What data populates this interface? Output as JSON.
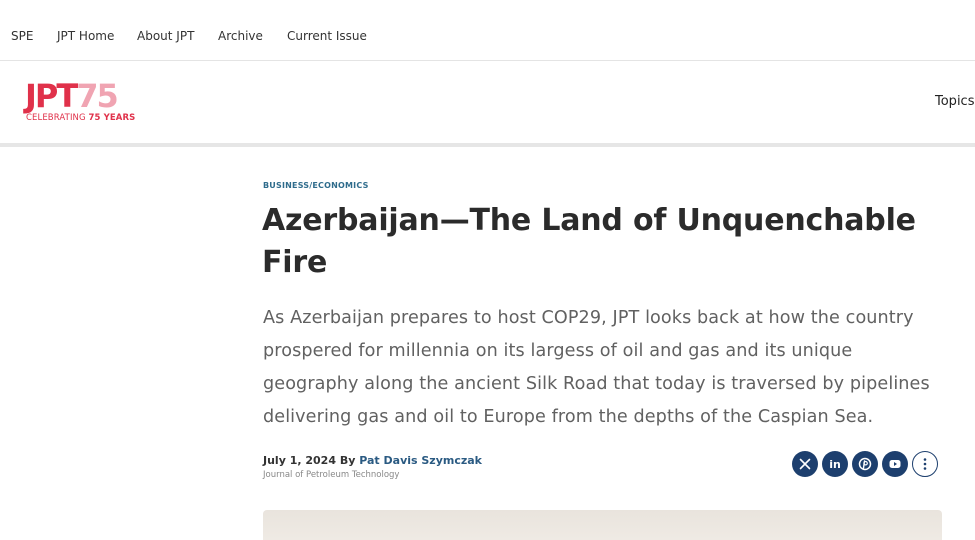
{
  "topnav": {
    "items": [
      "SPE",
      "JPT Home",
      "About JPT",
      "Archive",
      "Current Issue"
    ]
  },
  "masthead": {
    "logo_main_a": "JPT",
    "logo_main_b": "75",
    "logo_sub_a": "CELEBRATING ",
    "logo_sub_b": "75 YEARS",
    "topics_label": "Topics"
  },
  "article": {
    "category": "BUSINESS/ECONOMICS",
    "title": "Azerbaijan—The Land of Unquenchable Fire",
    "dek": "As Azerbaijan prepares to host COP29, JPT looks back at how the country prospered for millennia on its largess of oil and gas and its unique geography along the ancient Silk Road that today is traversed by pipelines delivering gas and oil to Europe from the depths of the Caspian Sea.",
    "date": "July 1, 2024",
    "by": "By",
    "author": "Pat Davis Szymczak",
    "source": "Journal of Petroleum Technology"
  },
  "share": {
    "icons": [
      "x-icon",
      "linkedin-icon",
      "pinterest-icon",
      "youtube-icon",
      "more-icon"
    ],
    "linkedin_text": "in"
  },
  "colors": {
    "brand_red": "#e0314a",
    "brand_pink": "#f0a4b2",
    "accent_blue": "#2a5a82",
    "share_navy": "#1d3f6e"
  }
}
